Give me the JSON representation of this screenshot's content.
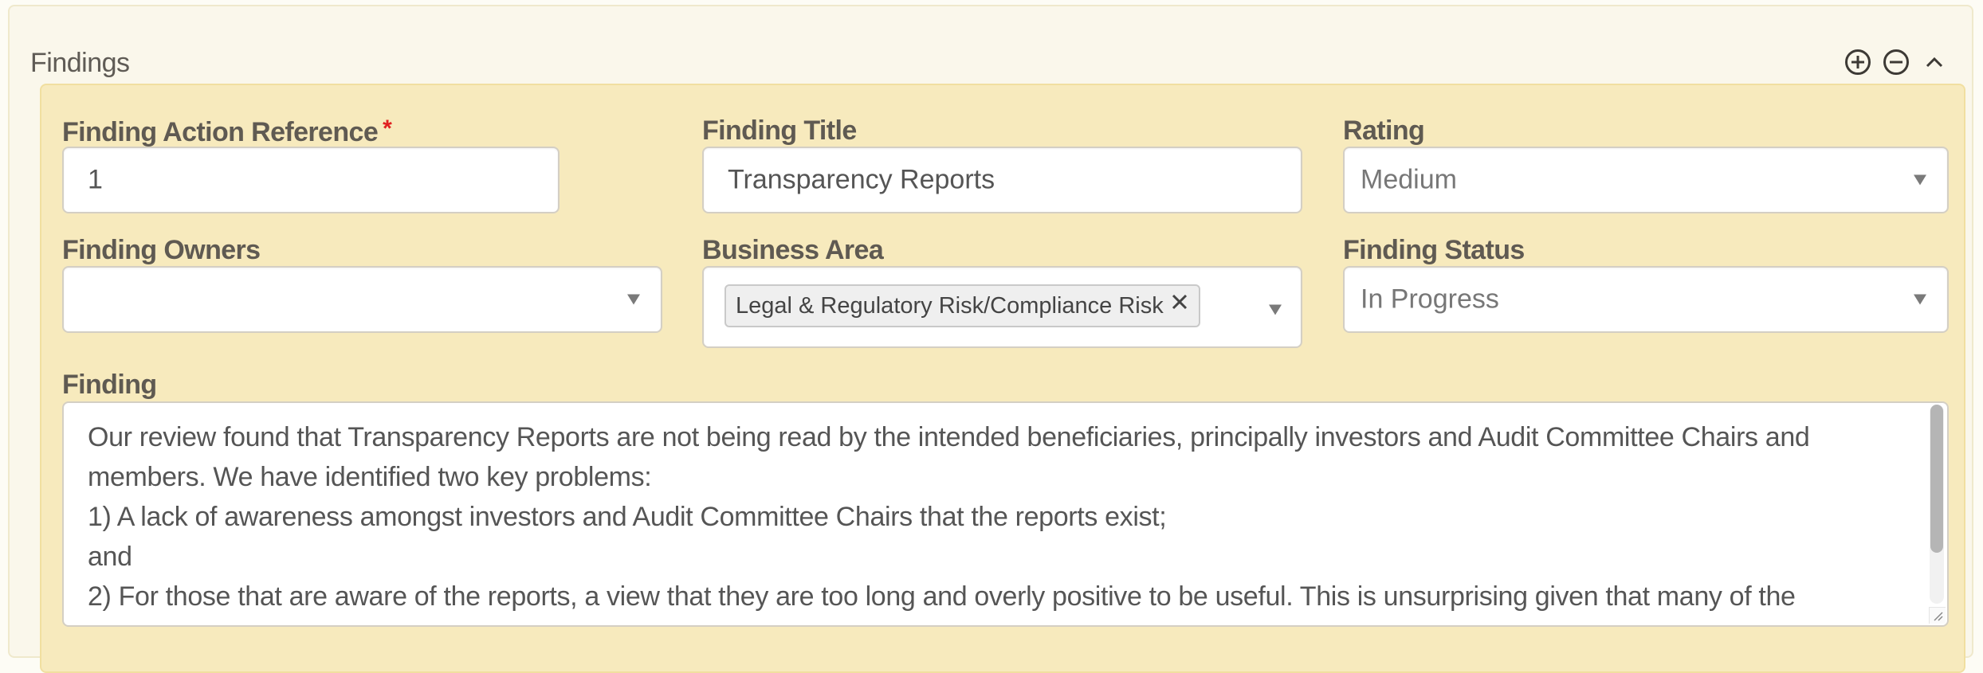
{
  "section": {
    "title": "Findings",
    "icons": {
      "add": "plus-circle-icon",
      "remove": "minus-circle-icon",
      "collapse": "chevron-up-icon"
    }
  },
  "fields": {
    "action_reference": {
      "label": "Finding Action Reference",
      "required_marker": "*",
      "value": "1"
    },
    "title": {
      "label": "Finding Title",
      "value": "Transparency Reports"
    },
    "rating": {
      "label": "Rating",
      "selected": "Medium"
    },
    "owners": {
      "label": "Finding Owners",
      "selected": ""
    },
    "business_area": {
      "label": "Business Area",
      "tags": [
        "Legal & Regulatory Risk/Compliance Risk"
      ]
    },
    "status": {
      "label": "Finding Status",
      "selected": "In Progress"
    },
    "finding": {
      "label": "Finding",
      "value": "Our review found that Transparency Reports are not being read by the intended beneficiaries, principally investors and Audit Committee Chairs and members. We have identified two key problems:\n1) A lack of awareness amongst investors and Audit Committee Chairs that the reports exist;\nand\n2) For those that are aware of the reports, a view that they are too long and overly positive to be useful. This is unsurprising given that many of the"
    }
  },
  "colors": {
    "outer_panel_bg": "#faf7eb",
    "inner_panel_bg": "#f7eabd",
    "label_text": "#5f5a52",
    "required": "#e02020"
  }
}
